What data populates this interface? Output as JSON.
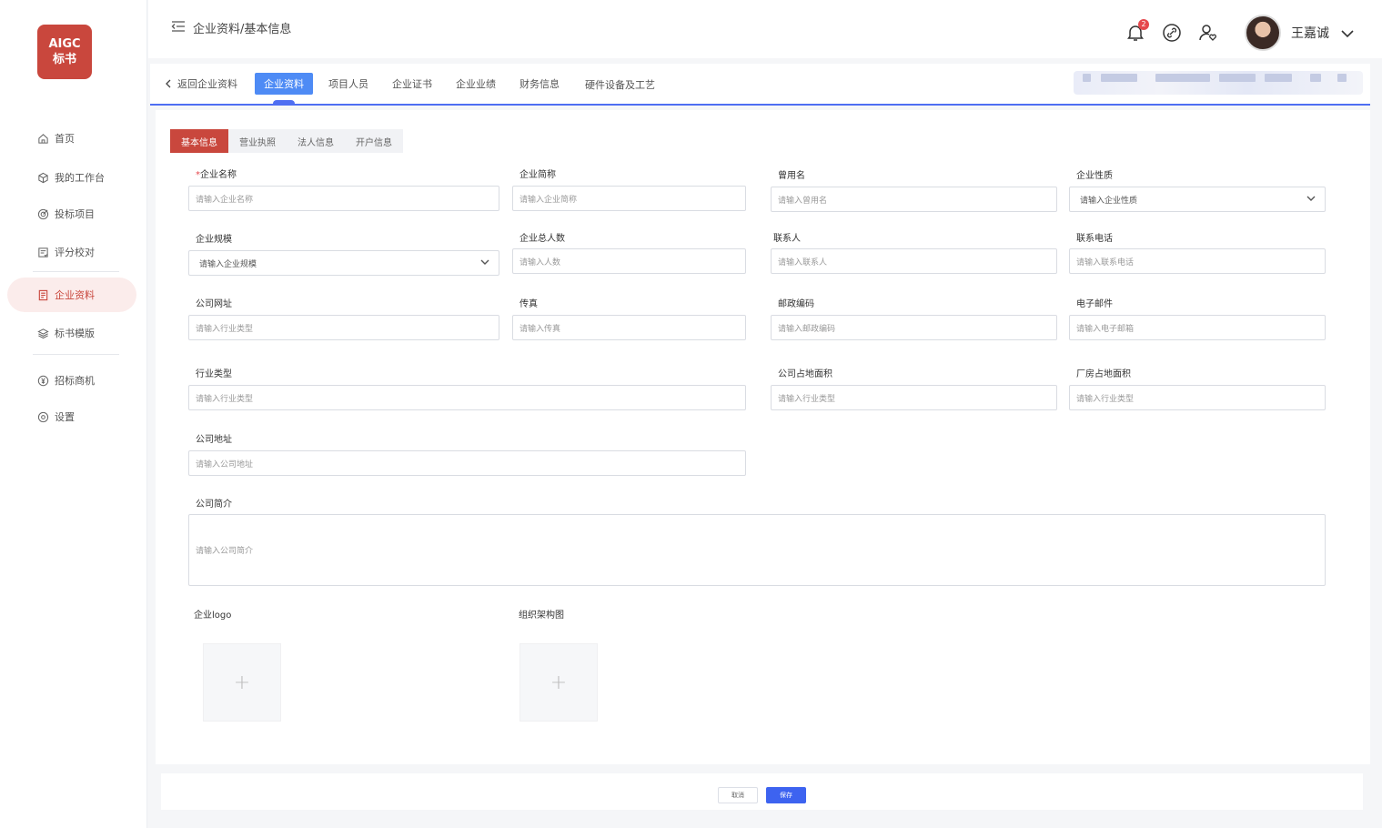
{
  "app": {
    "logo_line1": "AIGC",
    "logo_line2": "标书"
  },
  "sidebar": {
    "items": [
      {
        "label": "首页",
        "icon": "home-icon"
      },
      {
        "label": "我的工作台",
        "icon": "cube-icon"
      },
      {
        "label": "投标项目",
        "icon": "target-icon"
      },
      {
        "label": "评分校对",
        "icon": "checklist-icon"
      },
      {
        "label": "企业资料",
        "icon": "document-icon",
        "active": true
      },
      {
        "label": "标书模版",
        "icon": "layers-icon"
      },
      {
        "label": "招标商机",
        "icon": "yuan-coin-icon"
      },
      {
        "label": "设置",
        "icon": "gear-icon"
      }
    ]
  },
  "header": {
    "breadcrumb": "企业资料/基本信息",
    "notification_count": "2",
    "user_name": "王嘉诚"
  },
  "tabs": {
    "back": "返回企业资料",
    "items": [
      "企业资料",
      "项目人员",
      "企业证书",
      "企业业绩",
      "财务信息",
      "硬件设备及工艺"
    ]
  },
  "subtabs": [
    "基本信息",
    "营业执照",
    "法人信息",
    "开户信息"
  ],
  "form": {
    "company_name": {
      "label": "企业名称",
      "required_mark": "*",
      "placeholder": "请输入企业名称"
    },
    "short_name": {
      "label": "企业简称",
      "placeholder": "请输入企业简称"
    },
    "former_name": {
      "label": "曾用名",
      "placeholder": "请输入曾用名"
    },
    "nature": {
      "label": "企业性质",
      "placeholder": "请输入企业性质"
    },
    "scale": {
      "label": "企业规模",
      "placeholder": "请输入企业规模"
    },
    "headcount": {
      "label": "企业总人数",
      "placeholder": "请输入人数"
    },
    "contact": {
      "label": "联系人",
      "placeholder": "请输入联系人"
    },
    "phone": {
      "label": "联系电话",
      "placeholder": "请输入联系电话"
    },
    "website": {
      "label": "公司网址",
      "placeholder": "请输入行业类型"
    },
    "fax": {
      "label": "传真",
      "placeholder": "请输入传真"
    },
    "postcode": {
      "label": "邮政编码",
      "placeholder": "请输入邮政编码"
    },
    "email": {
      "label": "电子邮件",
      "placeholder": "请输入电子邮箱"
    },
    "industry": {
      "label": "行业类型",
      "placeholder": "请输入行业类型"
    },
    "company_area": {
      "label": "公司占地面积",
      "placeholder": "请输入行业类型"
    },
    "factory_area": {
      "label": "厂房占地面积",
      "placeholder": "请输入行业类型"
    },
    "address": {
      "label": "公司地址",
      "placeholder": "请输入公司地址"
    },
    "intro": {
      "label": "公司简介",
      "placeholder": "请输入公司简介"
    },
    "logo": {
      "label": "企业logo",
      "plus": "+"
    },
    "org_chart": {
      "label": "组织架构图",
      "plus": "+"
    }
  },
  "footer": {
    "cancel": "取消",
    "save": "保存"
  }
}
